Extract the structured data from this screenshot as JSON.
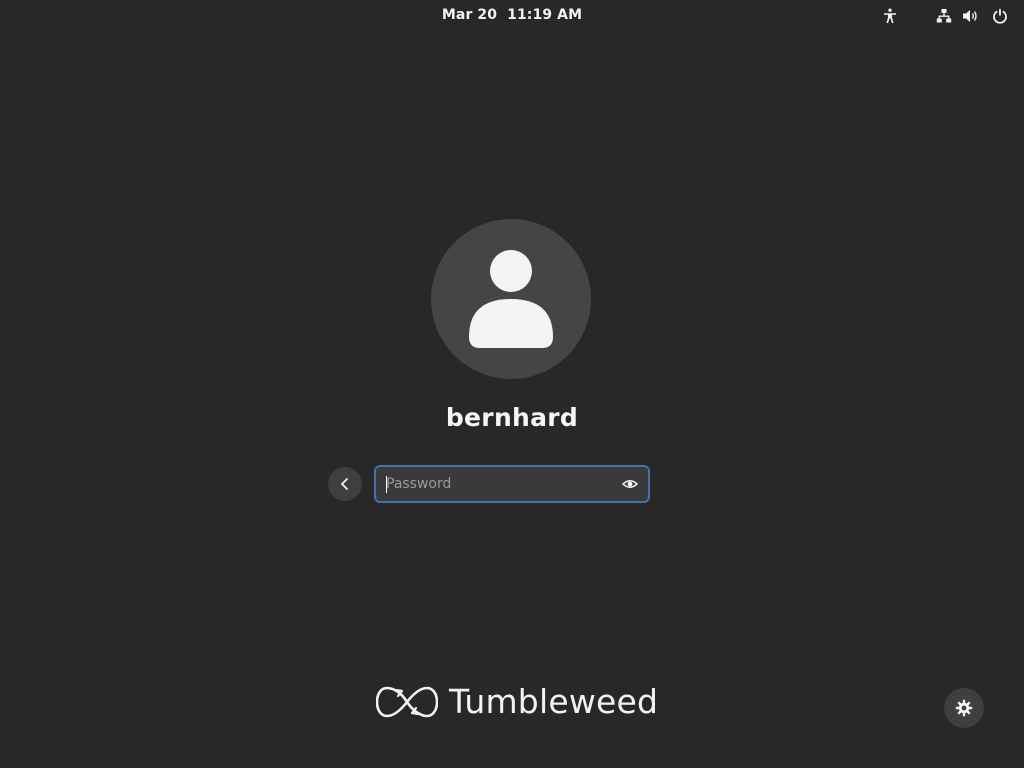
{
  "topbar": {
    "date": "Mar 20",
    "time": "11:19 AM",
    "icons": [
      "accessibility-icon",
      "network-wired-icon",
      "volume-icon",
      "power-icon"
    ]
  },
  "login": {
    "username": "bernhard",
    "password": {
      "value": "",
      "placeholder": "Password"
    },
    "back_icon": "chevron-left-icon",
    "reveal_icon": "eye-icon"
  },
  "branding": {
    "name": "Tumbleweed",
    "logo_icon": "opensuse-tumbleweed-logo"
  },
  "settings_icon": "gear-icon",
  "colors": {
    "background": "#282828",
    "avatar_bg": "#454545",
    "accent_focus": "#3e73b0",
    "entry_bg": "#3a3a3a",
    "button_bg": "#3f3f3f",
    "text": "#ffffff"
  }
}
